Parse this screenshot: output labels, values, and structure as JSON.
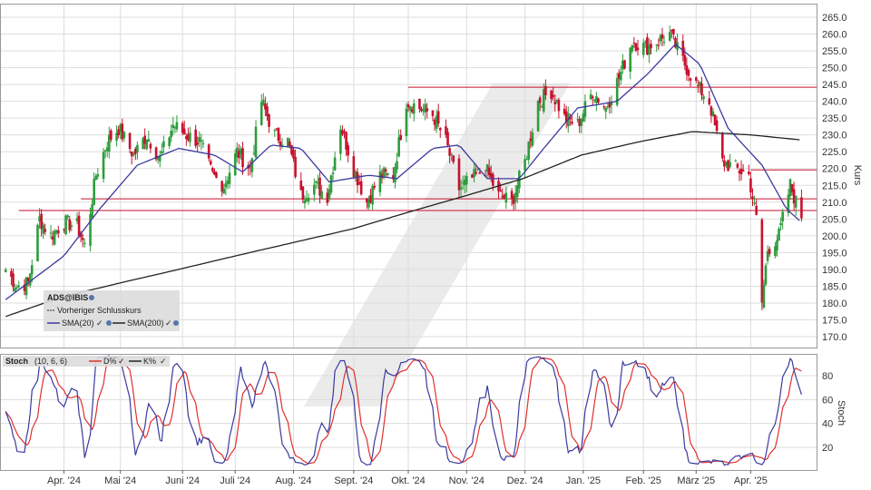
{
  "colors": {
    "up": "#2e9c3c",
    "down": "#c8102e",
    "sma20": "#3a3aa0",
    "sma200": "#222222",
    "hline": "#c8102e",
    "stoch_d": "#e03030",
    "stoch_k": "#3a3aa0",
    "grid": "#dddddd",
    "legend_bg": "#dcdcdc"
  },
  "legend": {
    "symbol": "ADS@IBIS",
    "prev_close": "Vorheriger Schlusskurs",
    "sma20": "SMA(20)",
    "sma200": "SMA(200)"
  },
  "stoch_legend": {
    "name": "Stoch",
    "params": "(10, 6, 6)",
    "d_label": "D%",
    "k_label": "K%"
  },
  "chart_data": [
    {
      "type": "candlestick",
      "ylabel": "Kurs",
      "ylim": [
        165,
        267
      ],
      "yticks": [
        "265.0",
        "260.0",
        "255.0",
        "250.0",
        "245.0",
        "240.0",
        "235.0",
        "230.0",
        "225.0",
        "220.0",
        "215.0",
        "210.0",
        "205.0",
        "200.0",
        "195.0",
        "190.0",
        "185.0",
        "180.0",
        "175.0",
        "170.0"
      ],
      "grid": true,
      "legend_position": "bottom-left",
      "horizontal_lines": [
        244.2,
        219.6,
        211.0,
        207.5
      ],
      "waypoints_close": [
        [
          "2024-03-01",
          190
        ],
        [
          "2024-03-07",
          185
        ],
        [
          "2024-03-13",
          186
        ],
        [
          "2024-03-19",
          205
        ],
        [
          "2024-03-25",
          200
        ],
        [
          "2024-04-01",
          204
        ],
        [
          "2024-04-08",
          203
        ],
        [
          "2024-04-12",
          197
        ],
        [
          "2024-04-18",
          218
        ],
        [
          "2024-04-24",
          228
        ],
        [
          "2024-04-30",
          232
        ],
        [
          "2024-05-08",
          224
        ],
        [
          "2024-05-15",
          230
        ],
        [
          "2024-05-22",
          223
        ],
        [
          "2024-05-29",
          233
        ],
        [
          "2024-06-05",
          230
        ],
        [
          "2024-06-12",
          228
        ],
        [
          "2024-06-19",
          218
        ],
        [
          "2024-06-25",
          215
        ],
        [
          "2024-07-02",
          225
        ],
        [
          "2024-07-09",
          220
        ],
        [
          "2024-07-15",
          240
        ],
        [
          "2024-07-22",
          230
        ],
        [
          "2024-07-29",
          228
        ],
        [
          "2024-08-05",
          212
        ],
        [
          "2024-08-12",
          215
        ],
        [
          "2024-08-19",
          212
        ],
        [
          "2024-08-26",
          233
        ],
        [
          "2024-09-02",
          220
        ],
        [
          "2024-09-09",
          210
        ],
        [
          "2024-09-16",
          218
        ],
        [
          "2024-09-23",
          218
        ],
        [
          "2024-09-30",
          240
        ],
        [
          "2024-10-07",
          238
        ],
        [
          "2024-10-14",
          236
        ],
        [
          "2024-10-21",
          228
        ],
        [
          "2024-10-28",
          214
        ],
        [
          "2024-11-04",
          217
        ],
        [
          "2024-11-11",
          220
        ],
        [
          "2024-11-18",
          212
        ],
        [
          "2024-11-25",
          210
        ],
        [
          "2024-12-02",
          222
        ],
        [
          "2024-12-09",
          240
        ],
        [
          "2024-12-16",
          243
        ],
        [
          "2024-12-23",
          235
        ],
        [
          "2024-12-30",
          233
        ],
        [
          "2025-01-07",
          243
        ],
        [
          "2025-01-14",
          238
        ],
        [
          "2025-01-21",
          247
        ],
        [
          "2025-01-28",
          258
        ],
        [
          "2025-02-04",
          256
        ],
        [
          "2025-02-11",
          258
        ],
        [
          "2025-02-17",
          260
        ],
        [
          "2025-02-24",
          252
        ],
        [
          "2025-03-03",
          245
        ],
        [
          "2025-03-10",
          240
        ],
        [
          "2025-03-17",
          222
        ],
        [
          "2025-03-24",
          220
        ],
        [
          "2025-03-31",
          218
        ],
        [
          "2025-04-04",
          205
        ],
        [
          "2025-04-07",
          180
        ],
        [
          "2025-04-10",
          196
        ],
        [
          "2025-04-16",
          200
        ],
        [
          "2025-04-22",
          215
        ],
        [
          "2025-04-25",
          210
        ],
        [
          "2025-04-28",
          206
        ]
      ],
      "sma20": [
        [
          "2024-03-01",
          181
        ],
        [
          "2024-04-01",
          194
        ],
        [
          "2024-04-20",
          208
        ],
        [
          "2024-05-10",
          221
        ],
        [
          "2024-06-01",
          226
        ],
        [
          "2024-06-20",
          224
        ],
        [
          "2024-07-05",
          219
        ],
        [
          "2024-07-20",
          227
        ],
        [
          "2024-08-05",
          226
        ],
        [
          "2024-08-20",
          216
        ],
        [
          "2024-09-10",
          218
        ],
        [
          "2024-09-25",
          217
        ],
        [
          "2024-10-14",
          226
        ],
        [
          "2024-10-28",
          227
        ],
        [
          "2024-11-12",
          217
        ],
        [
          "2024-11-29",
          217
        ],
        [
          "2024-12-12",
          226
        ],
        [
          "2024-12-30",
          238
        ],
        [
          "2025-01-20",
          240
        ],
        [
          "2025-02-05",
          248
        ],
        [
          "2025-02-20",
          257
        ],
        [
          "2025-03-05",
          251
        ],
        [
          "2025-03-20",
          232
        ],
        [
          "2025-04-07",
          221
        ],
        [
          "2025-04-20",
          208
        ],
        [
          "2025-04-28",
          204
        ]
      ],
      "sma200": [
        [
          "2024-03-01",
          176
        ],
        [
          "2024-04-01",
          182
        ],
        [
          "2024-05-01",
          186
        ],
        [
          "2024-06-01",
          190
        ],
        [
          "2024-07-01",
          194
        ],
        [
          "2024-08-01",
          198
        ],
        [
          "2024-09-01",
          202
        ],
        [
          "2024-10-01",
          207
        ],
        [
          "2024-11-01",
          212
        ],
        [
          "2024-12-01",
          217
        ],
        [
          "2025-01-01",
          224
        ],
        [
          "2025-02-01",
          228
        ],
        [
          "2025-03-01",
          231
        ],
        [
          "2025-04-01",
          230
        ],
        [
          "2025-04-28",
          228.5
        ]
      ]
    },
    {
      "type": "line",
      "ylabel": "Stoch",
      "ylim": [
        0,
        100
      ],
      "yticks": [
        80,
        60,
        40,
        20
      ],
      "series": [
        {
          "name": "D%",
          "color": "#e03030"
        },
        {
          "name": "K%",
          "color": "#3a3aa0"
        }
      ]
    }
  ],
  "x_axis": {
    "labels": [
      "Apr. '24",
      "Mai '24",
      "Juni '24",
      "Juli '24",
      "Aug. '24",
      "Sept. '24",
      "Okt. '24",
      "Nov. '24",
      "Dez. '24",
      "Jan. '25",
      "Feb. '25",
      "März '25",
      "Apr. '25"
    ],
    "ticks": [
      "2024-04-01",
      "2024-05-01",
      "2024-06-03",
      "2024-07-01",
      "2024-08-01",
      "2024-09-02",
      "2024-10-01",
      "2024-11-01",
      "2024-12-02",
      "2025-01-02",
      "2025-02-03",
      "2025-03-03",
      "2025-04-01"
    ],
    "range": [
      "2024-02-27",
      "2025-05-06"
    ]
  }
}
